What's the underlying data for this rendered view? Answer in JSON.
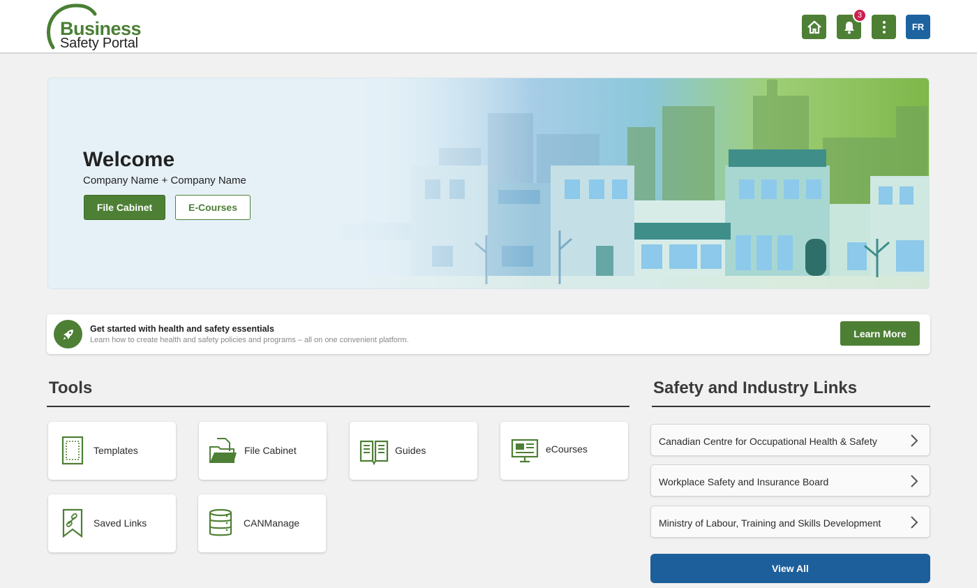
{
  "header": {
    "logo_line1": "Business",
    "logo_line2": "Safety Portal",
    "notification_count": "3",
    "lang_label": "FR",
    "icons": [
      "home-icon",
      "bell-icon",
      "more-vertical-icon"
    ]
  },
  "hero": {
    "title": "Welcome",
    "subtitle": "Company Name + Company Name",
    "primary_button": "File Cabinet",
    "secondary_button": "E-Courses"
  },
  "banner": {
    "title": "Get started with health and safety essentials",
    "subtitle": "Learn how to create health and safety policies and programs – all on one convenient platform.",
    "button": "Learn More",
    "icon": "rocket-icon"
  },
  "tools": {
    "title": "Tools",
    "items": [
      {
        "label": "Templates",
        "icon": "template-icon"
      },
      {
        "label": "File Cabinet",
        "icon": "folder-icon"
      },
      {
        "label": "Guides",
        "icon": "book-icon"
      },
      {
        "label": "eCourses",
        "icon": "monitor-icon"
      },
      {
        "label": "Saved Links",
        "icon": "bookmark-link-icon"
      },
      {
        "label": "CANManage",
        "icon": "database-icon"
      }
    ]
  },
  "links": {
    "title": "Safety and Industry Links",
    "items": [
      {
        "label": "Canadian Centre for Occupational Health & Safety"
      },
      {
        "label": "Workplace Safety and Insurance Board"
      },
      {
        "label": "Ministry of Labour, Training and Skills Development"
      }
    ],
    "view_all": "View All"
  },
  "colors": {
    "brand_green": "#4d7f35",
    "brand_blue": "#1d63a0",
    "badge_red": "#cc1f4f"
  }
}
